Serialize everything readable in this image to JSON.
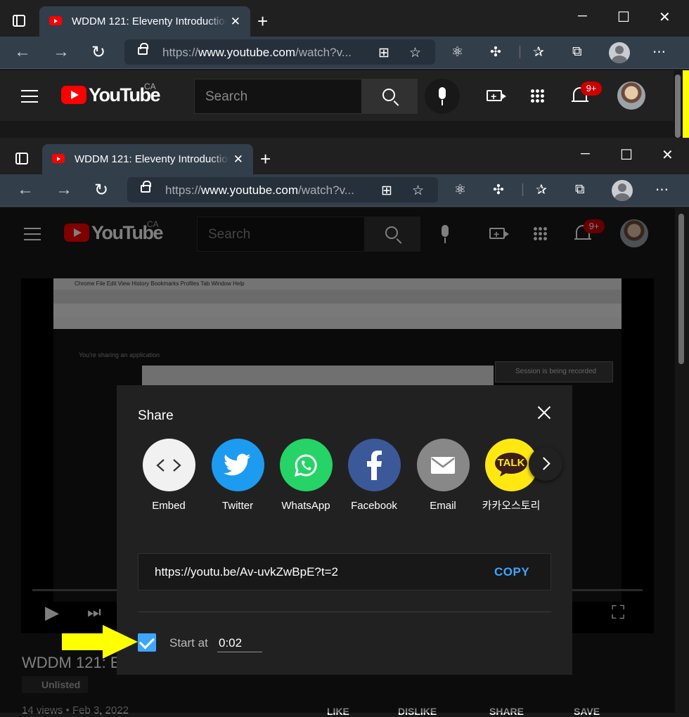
{
  "browser": {
    "tab_title": "WDDM 121: Eleventy Introduction",
    "tab_close": "✕",
    "new_tab": "+",
    "minimize": "─",
    "maximize": "☐",
    "close": "✕",
    "back": "←",
    "forward": "→",
    "refresh": "↻",
    "url_prefix": "https://",
    "url_domain": "www.youtube.com",
    "url_path": "/watch?v..."
  },
  "youtube": {
    "logo_text": "YouTube",
    "region": "CA",
    "search_placeholder": "Search",
    "notifications_badge": "9+",
    "brand_color": "#ff0000"
  },
  "embedded_screenshot": {
    "mac_menu": "Chrome   File   Edit   View   History   Bookmarks   Profiles   Tab   Window   Help",
    "sharing_text": "You're sharing an application",
    "recording_text": "Session is being recorded"
  },
  "video_page": {
    "title_partial": "WDDM 121: E",
    "visibility": "Unlisted",
    "meta": "14 views • Feb 3, 2022",
    "actions": [
      "LIKE",
      "DISLIKE",
      "SHARE",
      "SAVE"
    ]
  },
  "share_dialog": {
    "title": "Share",
    "services": [
      {
        "label": "Embed",
        "icon": "embed-icon",
        "color": "#f1f1f1"
      },
      {
        "label": "Twitter",
        "icon": "twitter-icon",
        "color": "#1d9bf0"
      },
      {
        "label": "WhatsApp",
        "icon": "whatsapp-icon",
        "color": "#25d366"
      },
      {
        "label": "Facebook",
        "icon": "facebook-icon",
        "color": "#3b5998"
      },
      {
        "label": "Email",
        "icon": "email-icon",
        "color": "#888888"
      },
      {
        "label": "카카오스토리",
        "icon": "kakaotalk-icon",
        "color": "#ffe812",
        "glyph": "TALK"
      }
    ],
    "share_link": "https://youtu.be/Av-uvkZwBpE?t=2",
    "copy_label": "COPY",
    "start_at_checked": true,
    "start_at_label": "Start at",
    "start_at_time": "0:02",
    "accent_color": "#3ea6ff"
  },
  "annotation": {
    "arrow_color": "#ffff00"
  }
}
